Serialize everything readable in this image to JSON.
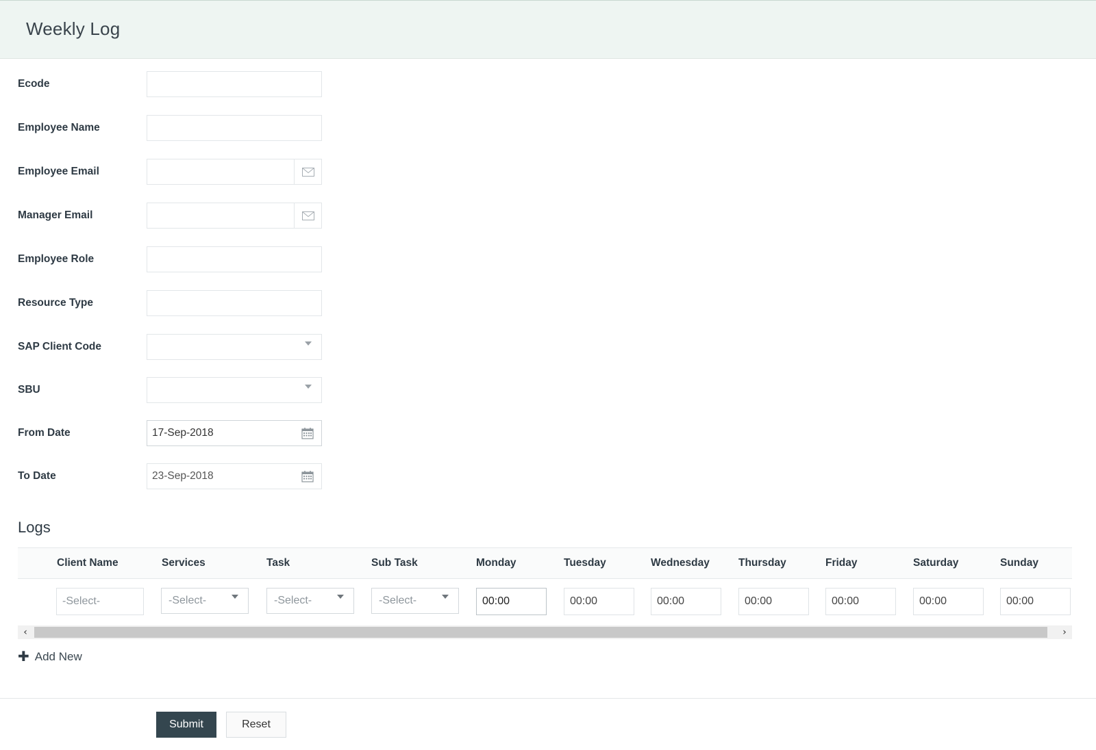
{
  "header": {
    "title": "Weekly Log"
  },
  "form": {
    "ecode": {
      "label": "Ecode",
      "value": ""
    },
    "employee_name": {
      "label": "Employee Name",
      "value": ""
    },
    "employee_email": {
      "label": "Employee Email",
      "value": "",
      "icon": "mail-icon"
    },
    "manager_email": {
      "label": "Manager Email",
      "value": "",
      "icon": "mail-icon"
    },
    "employee_role": {
      "label": "Employee Role",
      "value": ""
    },
    "resource_type": {
      "label": "Resource Type",
      "value": ""
    },
    "sap_client_code": {
      "label": "SAP Client Code",
      "value": ""
    },
    "sbu": {
      "label": "SBU",
      "value": ""
    },
    "from_date": {
      "label": "From Date",
      "value": "17-Sep-2018",
      "icon": "calendar-icon"
    },
    "to_date": {
      "label": "To Date",
      "value": "23-Sep-2018",
      "icon": "calendar-icon"
    }
  },
  "logs": {
    "title": "Logs",
    "columns": [
      "Client Name",
      "Services",
      "Task",
      "Sub Task",
      "Monday",
      "Tuesday",
      "Wednesday",
      "Thursday",
      "Friday",
      "Saturday",
      "Sunday"
    ],
    "row": {
      "client_name": "-Select-",
      "services": "-Select-",
      "task": "-Select-",
      "sub_task": "-Select-",
      "monday": "00:00",
      "tuesday": "00:00",
      "wednesday": "00:00",
      "thursday": "00:00",
      "friday": "00:00",
      "saturday": "00:00",
      "sunday": "00:00"
    },
    "scroll_left": "‹",
    "scroll_right": "›",
    "add_new": "Add New",
    "add_icon": "plus-icon"
  },
  "actions": {
    "submit": "Submit",
    "reset": "Reset"
  },
  "colors": {
    "header_bg": "#eef5f2",
    "submit_bg": "#34464f"
  }
}
